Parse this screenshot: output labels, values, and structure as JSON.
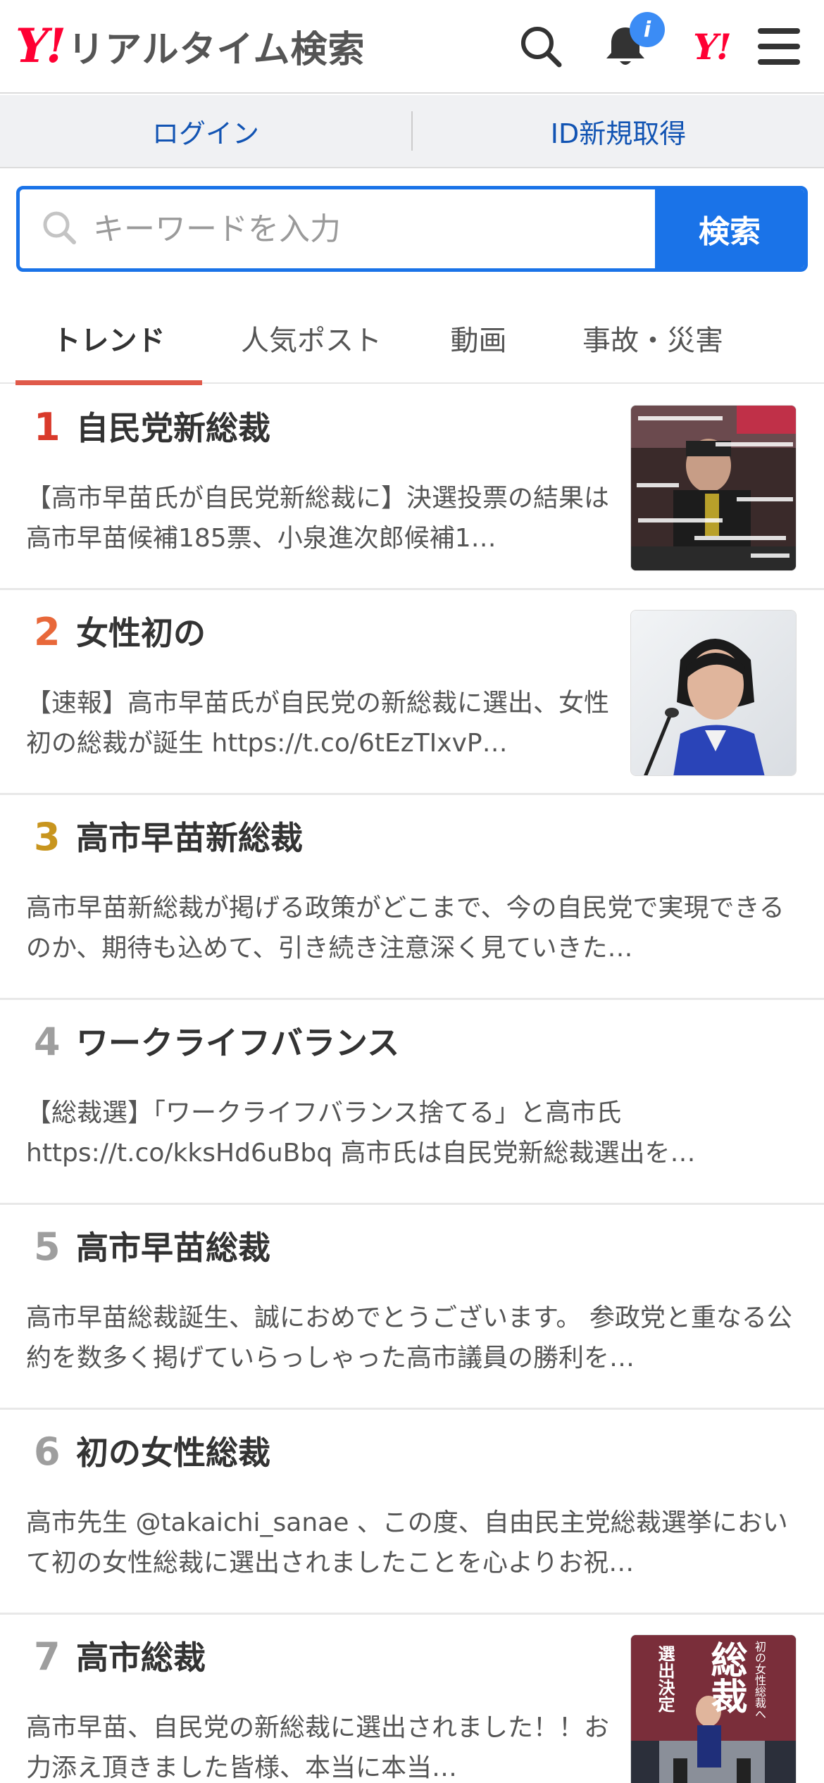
{
  "header": {
    "logo_mark": "Y!",
    "logo_text": "リアルタイム検索",
    "notification_badge": "i",
    "yahoo_mark": "Y!",
    "icons": [
      "search-icon",
      "bell-icon",
      "yahoo-logo-icon",
      "menu-icon"
    ]
  },
  "auth": {
    "login_label": "ログイン",
    "register_label": "ID新規取得"
  },
  "search": {
    "placeholder": "キーワードを入力",
    "button_label": "検索"
  },
  "tabs": [
    {
      "label": "トレンド",
      "active": true
    },
    {
      "label": "人気ポスト",
      "active": false
    },
    {
      "label": "動画",
      "active": false
    },
    {
      "label": "事故・災害",
      "active": false
    }
  ],
  "trends": [
    {
      "rank": "1",
      "rank_color": "#d93a2b",
      "title": "自民党新総裁",
      "description": "【高市早苗氏が自民党新総裁に】決選投票の結果は高市早苗候補185票、小泉進次郎候補1…",
      "has_thumb": true
    },
    {
      "rank": "2",
      "rank_color": "#e8683a",
      "title": "女性初の",
      "description": "【速報】高市早苗氏が自民党の新総裁に選出、女性初の総裁が誕生 https://t.co/6tEzTIxvP…",
      "has_thumb": true
    },
    {
      "rank": "3",
      "rank_color": "#c8951e",
      "title": "高市早苗新総裁",
      "description": "高市早苗新総裁が掲げる政策がどこまで、今の自民党で実現できるのか、期待も込めて、引き続き注意深く見ていきた…",
      "has_thumb": false
    },
    {
      "rank": "4",
      "rank_color": "#9e9e9e",
      "title": "ワークライフバランス",
      "description": "【総裁選】「ワークライフバランス捨てる」と高市氏 https://t.co/kksHd6uBbq 高市氏は自民党新総裁選出を…",
      "has_thumb": false
    },
    {
      "rank": "5",
      "rank_color": "#9e9e9e",
      "title": "高市早苗総裁",
      "description": "高市早苗総裁誕生、誠におめでとうございます。 参政党と重なる公約を数多く掲げていらっしゃった高市議員の勝利を…",
      "has_thumb": false
    },
    {
      "rank": "6",
      "rank_color": "#9e9e9e",
      "title": "初の女性総裁",
      "description": "高市先生 @takaichi_sanae 、この度、自由民主党総裁選挙において初の女性総裁に選出されましたことを心よりお祝…",
      "has_thumb": false
    },
    {
      "rank": "7",
      "rank_color": "#9e9e9e",
      "title": "高市総裁",
      "description": "高市早苗、自民党の新総裁に選出されました！！お力添え頂きました皆様、本当に本当…",
      "has_thumb": true
    }
  ],
  "thumb3_text": {
    "big": "総裁",
    "side": "選出決定",
    "top": "初の女性総裁へ"
  }
}
